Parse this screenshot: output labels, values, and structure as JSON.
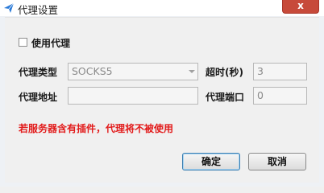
{
  "window": {
    "title": "代理设置",
    "close_glyph": "x",
    "icon": "paper-plane-icon"
  },
  "proxy": {
    "use_proxy_label": "使用代理",
    "use_proxy_checked": false,
    "type_label": "代理类型",
    "type_value": "SOCKS5",
    "timeout_label": "超时(秒)",
    "timeout_value": "3",
    "address_label": "代理地址",
    "address_value": "",
    "port_label": "代理端口",
    "port_value": "0"
  },
  "warning": "若服务器含有插件，代理将不被使用",
  "buttons": {
    "ok": "确定",
    "cancel": "取消"
  },
  "colors": {
    "warning": "#e21b1b",
    "close": "#c74a3a"
  }
}
